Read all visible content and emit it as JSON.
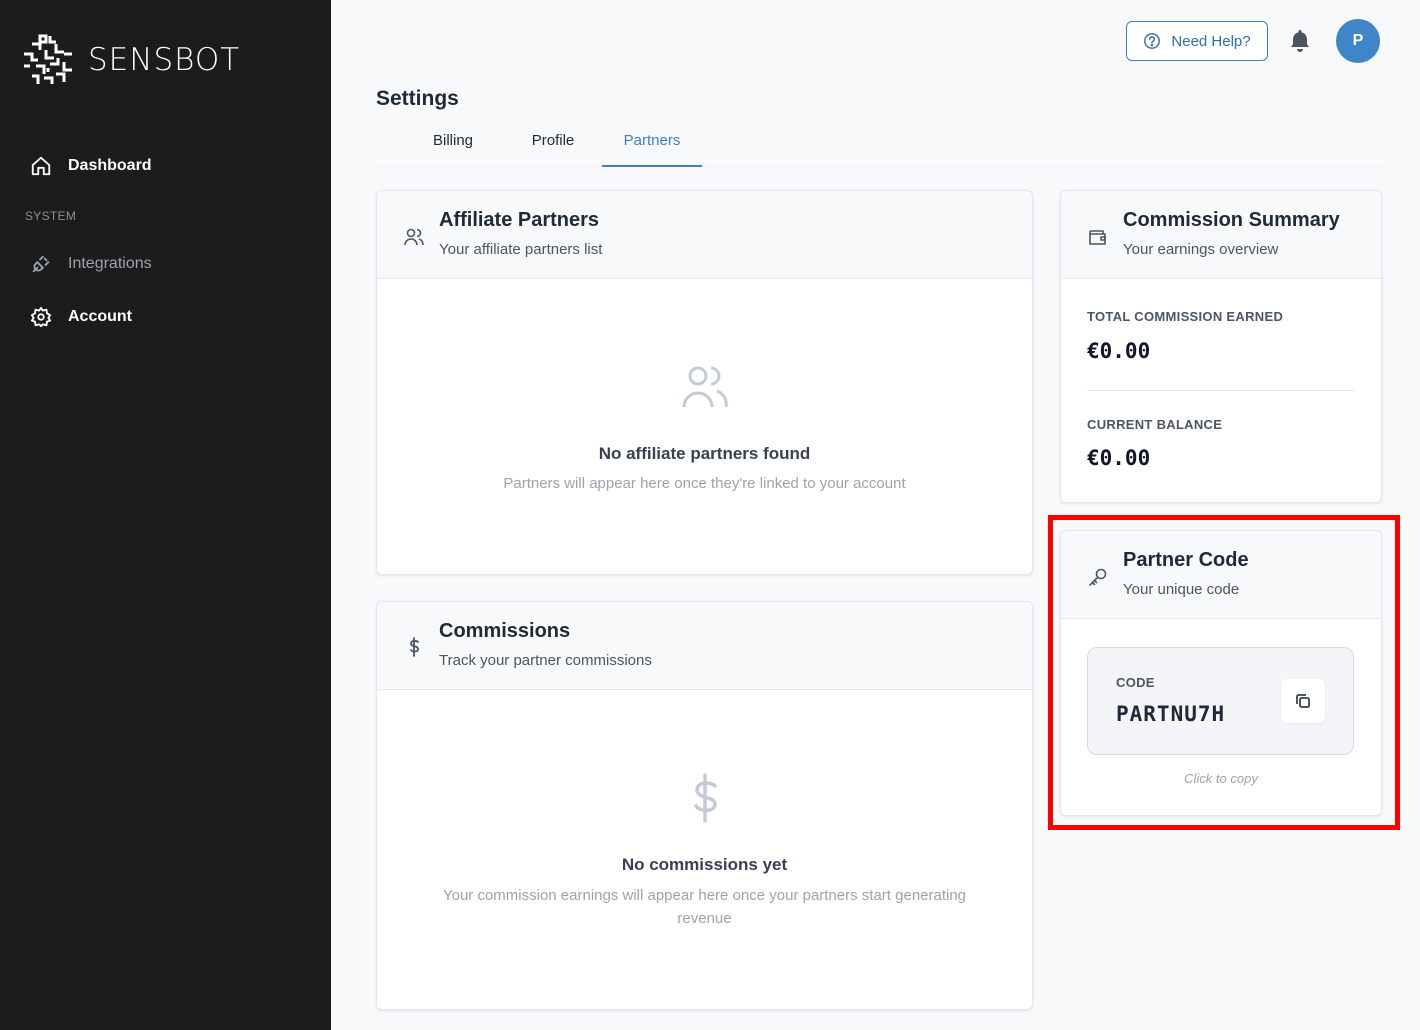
{
  "app": {
    "brand": "SENSBOT"
  },
  "sidebar": {
    "items": [
      {
        "label": "Dashboard",
        "icon": "home-icon"
      },
      {
        "label": "Integrations",
        "icon": "plug-icon"
      },
      {
        "label": "Account",
        "icon": "gear-icon"
      }
    ],
    "section_label": "SYSTEM"
  },
  "header": {
    "help_label": "Need Help?",
    "avatar_initial": "P"
  },
  "page": {
    "title": "Settings",
    "tabs": [
      {
        "label": "Billing"
      },
      {
        "label": "Profile"
      },
      {
        "label": "Partners",
        "active": true
      }
    ]
  },
  "affiliate": {
    "title": "Affiliate Partners",
    "subtitle": "Your affiliate partners list",
    "empty_title": "No affiliate partners found",
    "empty_sub": "Partners will appear here once they're linked to your account"
  },
  "commissions": {
    "title": "Commissions",
    "subtitle": "Track your partner commissions",
    "empty_title": "No commissions yet",
    "empty_sub": "Your commission earnings will appear here once your partners start generating revenue"
  },
  "summary": {
    "title": "Commission Summary",
    "subtitle": "Your earnings overview",
    "total_label": "TOTAL COMMISSION EARNED",
    "total_value": "€0.00",
    "balance_label": "CURRENT BALANCE",
    "balance_value": "€0.00"
  },
  "partner_code": {
    "title": "Partner Code",
    "subtitle": "Your unique code",
    "code_label": "CODE",
    "code_value": "PARTNU7H",
    "hint": "Click to copy"
  },
  "colors": {
    "accent": "#3b82c4",
    "sidebar_bg": "#1c1c1c",
    "highlight": "#ff0000"
  }
}
